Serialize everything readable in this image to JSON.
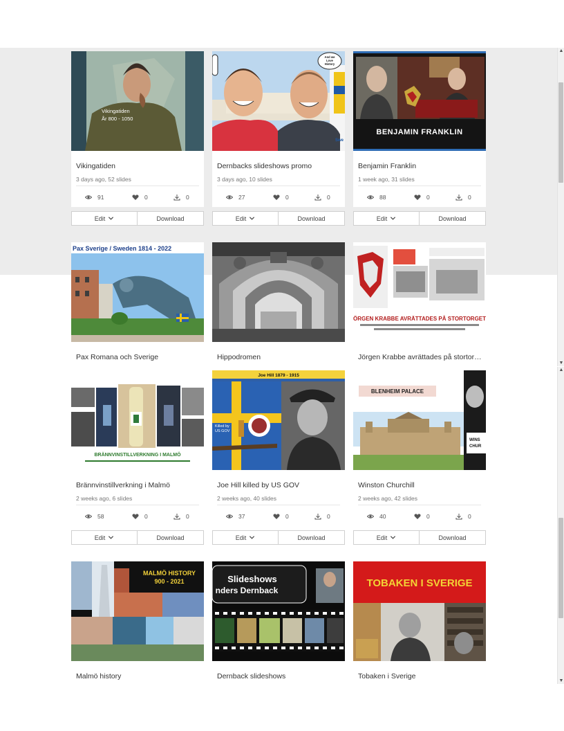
{
  "icons": {
    "views": "eye-icon",
    "likes": "heart-icon",
    "downloads": "download-icon",
    "edit_menu": "chevron-down-icon"
  },
  "buttons": {
    "edit": "Edit",
    "download": "Download"
  },
  "row1": [
    {
      "title": "Vikingatiden",
      "meta": "3 days ago, 52 slides",
      "views": "91",
      "likes": "0",
      "downloads": "0",
      "thumb_text": [
        "Vikingatiden",
        "År 800 - 1050"
      ]
    },
    {
      "title": "Dernbacks slideshows promo",
      "meta": "3 days ago, 10 slides",
      "views": "27",
      "likes": "0",
      "downloads": "0",
      "thumb_text": [
        "And we",
        "Love",
        "History",
        "Swe"
      ]
    },
    {
      "title": "Benjamin Franklin",
      "meta": "1 week ago, 31 slides",
      "views": "88",
      "likes": "0",
      "downloads": "0",
      "thumb_text": [
        "BENJAMIN FRANKLIN"
      ]
    }
  ],
  "row2": [
    {
      "title": "Pax Romana och Sverige",
      "thumb_text": [
        "Pax Sverige / Sweden 1814 - 2022"
      ]
    },
    {
      "title": "Hippodromen",
      "thumb_text": []
    },
    {
      "title": "Jörgen Krabbe avrättades på stortorg…",
      "thumb_text": [
        "ÖRGEN KRABBE AVRÄTTADES PÅ STORTORGET"
      ]
    }
  ],
  "row3": [
    {
      "title": "Brännvinstillverkning i Malmö",
      "meta": "2 weeks ago, 6 slides",
      "views": "58",
      "likes": "0",
      "downloads": "0",
      "thumb_text": [
        "BRÄNNVINSTILLVERKNING I MALMÖ"
      ]
    },
    {
      "title": "Joe Hill killed by US GOV",
      "meta": "2 weeks ago, 40 slides",
      "views": "37",
      "likes": "0",
      "downloads": "0",
      "thumb_text": [
        "Joe Hill  1879 - 1915",
        "Killed by",
        "US GOV"
      ]
    },
    {
      "title": "Winston Churchill",
      "meta": "2 weeks ago, 42 slides",
      "views": "40",
      "likes": "0",
      "downloads": "0",
      "thumb_text": [
        "BLENHEIM PALACE",
        "WINS",
        "CHUR"
      ]
    }
  ],
  "row4": [
    {
      "title": "Malmö history",
      "thumb_text": [
        "MALMÖ HISTORY",
        "900 - 2021"
      ]
    },
    {
      "title": "Dernback slideshows",
      "thumb_text": [
        "Slideshows",
        "nders Dernback"
      ]
    },
    {
      "title": "Tobaken i Sverige",
      "thumb_text": [
        "TOBAKEN I SVERIGE"
      ]
    }
  ]
}
